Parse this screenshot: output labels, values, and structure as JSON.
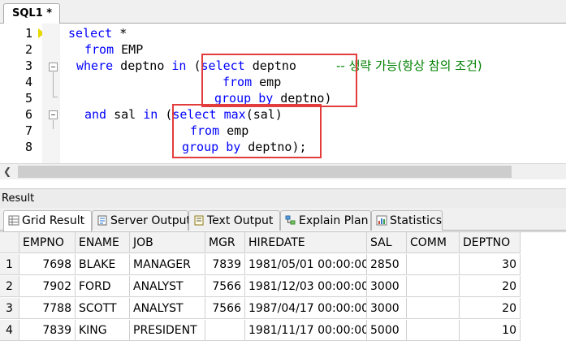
{
  "editor_tab": {
    "label": "SQL1 *"
  },
  "line_numbers": [
    "1",
    "2",
    "3",
    "4",
    "5",
    "6",
    "7",
    "8"
  ],
  "code": {
    "l1_kw": "select",
    "l1_tx": " *",
    "l2_kw": "from",
    "l2_tx": " EMP",
    "l3_kw1": "where",
    "l3_tx1": " deptno ",
    "l3_kw2": "in",
    "l3_tx2": " (",
    "l3_kw3": "select",
    "l3_tx3": " deptno",
    "l3_comment": "-- 생략 가능(항상 참의 조건)",
    "l4_kw": "from",
    "l4_tx": " emp",
    "l5_kw1": "group",
    "l5_kw2": "by",
    "l5_tx": " deptno)",
    "l6_kw1": "and",
    "l6_tx1": " sal ",
    "l6_kw2": "in",
    "l6_tx2": " (",
    "l6_kw3": "select",
    "l6_kw4": "max",
    "l6_tx3": "(sal)",
    "l7_kw": "from",
    "l7_tx": " emp",
    "l8_kw1": "group",
    "l8_kw2": "by",
    "l8_tx": " deptno);"
  },
  "result_panel": {
    "title": "Result",
    "tabs": [
      {
        "label": "Grid Result",
        "icon": "grid-icon",
        "active": true
      },
      {
        "label": "Server Output",
        "icon": "server-output-icon"
      },
      {
        "label": "Text Output",
        "icon": "text-output-icon"
      },
      {
        "label": "Explain Plan",
        "icon": "explain-plan-icon"
      },
      {
        "label": "Statistics",
        "icon": "statistics-icon"
      }
    ]
  },
  "grid": {
    "columns": [
      "EMPNO",
      "ENAME",
      "JOB",
      "MGR",
      "HIREDATE",
      "SAL",
      "COMM",
      "DEPTNO"
    ],
    "rows": [
      {
        "n": "1",
        "cells": [
          "7698",
          "BLAKE",
          "MANAGER",
          "7839",
          "1981/05/01 00:00:00",
          "2850",
          "",
          "30"
        ]
      },
      {
        "n": "2",
        "cells": [
          "7902",
          "FORD",
          "ANALYST",
          "7566",
          "1981/12/03 00:00:00",
          "3000",
          "",
          "20"
        ]
      },
      {
        "n": "3",
        "cells": [
          "7788",
          "SCOTT",
          "ANALYST",
          "7566",
          "1987/04/17 00:00:00",
          "3000",
          "",
          "20"
        ]
      },
      {
        "n": "4",
        "cells": [
          "7839",
          "KING",
          "PRESIDENT",
          "",
          "1981/11/17 00:00:00",
          "5000",
          "",
          "10"
        ]
      }
    ]
  },
  "colors": {
    "keyword": "#0000ff",
    "comment": "#008000",
    "highlight_box": "#e33c3c"
  }
}
